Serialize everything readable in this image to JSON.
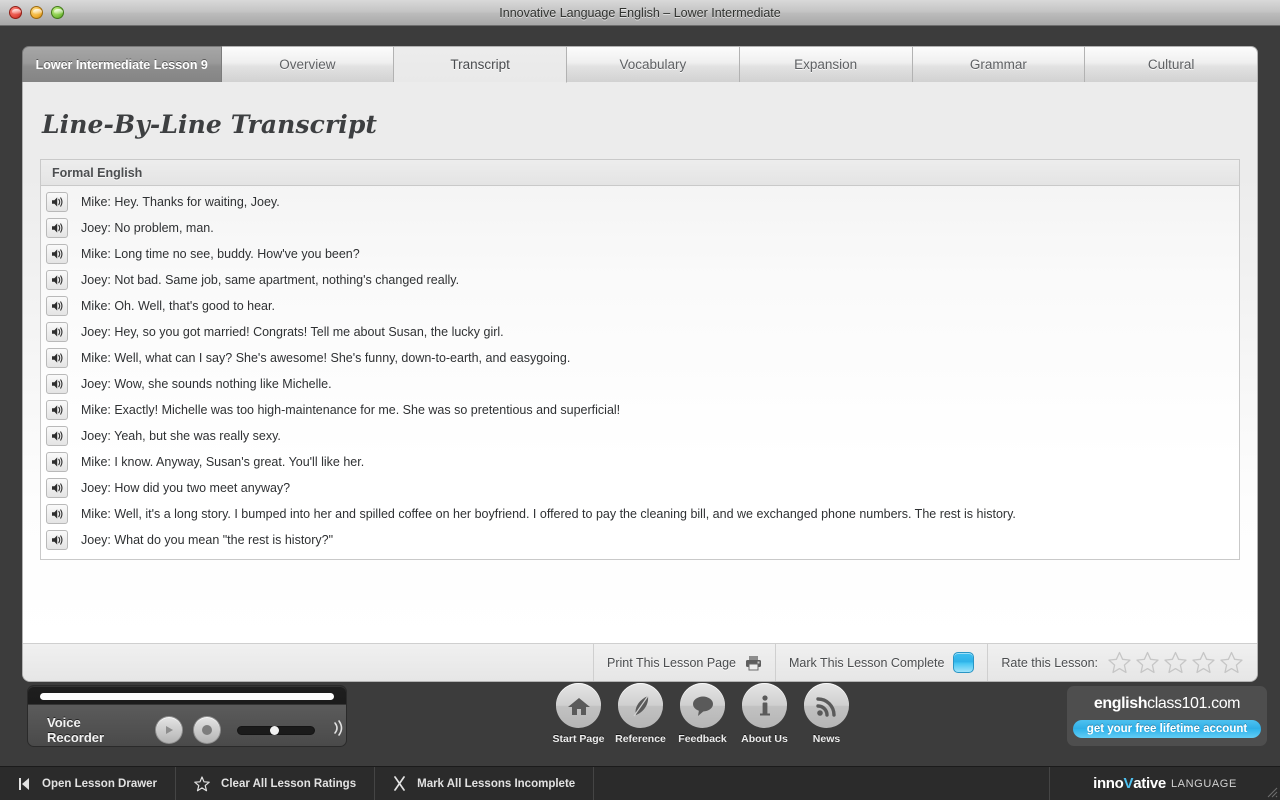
{
  "window": {
    "title": "Innovative Language English – Lower Intermediate",
    "traffic_lights": [
      "close",
      "minimize",
      "zoom"
    ]
  },
  "tabs": [
    {
      "label": "Lower Intermediate Lesson 9",
      "type": "lesson",
      "active": false
    },
    {
      "label": "Overview",
      "type": "tab",
      "active": false
    },
    {
      "label": "Transcript",
      "type": "tab",
      "active": true
    },
    {
      "label": "Vocabulary",
      "type": "tab",
      "active": false
    },
    {
      "label": "Expansion",
      "type": "tab",
      "active": false
    },
    {
      "label": "Grammar",
      "type": "tab",
      "active": false
    },
    {
      "label": "Cultural",
      "type": "tab",
      "active": false
    }
  ],
  "page": {
    "title": "Line-By-Line Transcript",
    "section_header": "Formal English"
  },
  "transcript": [
    {
      "speaker": "Mike",
      "line": "Mike: Hey. Thanks for waiting, Joey."
    },
    {
      "speaker": "Joey",
      "line": "Joey: No problem, man."
    },
    {
      "speaker": "Mike",
      "line": "Mike: Long time no see, buddy. How've you been?"
    },
    {
      "speaker": "Joey",
      "line": "Joey: Not bad. Same job, same apartment, nothing's changed really."
    },
    {
      "speaker": "Mike",
      "line": "Mike: Oh. Well, that's good to hear."
    },
    {
      "speaker": "Joey",
      "line": "Joey: Hey, so you got married! Congrats! Tell me about Susan, the lucky girl."
    },
    {
      "speaker": "Mike",
      "line": "Mike: Well, what can I say? She's awesome! She's funny, down-to-earth, and easygoing."
    },
    {
      "speaker": "Joey",
      "line": "Joey: Wow, she sounds nothing like Michelle."
    },
    {
      "speaker": "Mike",
      "line": "Mike: Exactly! Michelle was too high-maintenance for me. She was so pretentious and superficial!"
    },
    {
      "speaker": "Joey",
      "line": "Joey: Yeah, but she was really sexy."
    },
    {
      "speaker": "Mike",
      "line": "Mike: I know. Anyway, Susan's great. You'll like her."
    },
    {
      "speaker": "Joey",
      "line": "Joey: How did you two meet anyway?"
    },
    {
      "speaker": "Mike",
      "line": "Mike: Well, it's a long story. I bumped into her and spilled coffee on her boyfriend. I offered to pay the cleaning bill, and we exchanged phone numbers. The rest is history."
    },
    {
      "speaker": "Joey",
      "line": "Joey: What do you mean \"the rest is history?\""
    }
  ],
  "panel_footer": {
    "print_label": "Print This Lesson Page",
    "print_icon": "printer-icon",
    "complete_label": "Mark This Lesson Complete",
    "complete_checked": false,
    "rate_label": "Rate this Lesson:",
    "stars_total": 5,
    "stars_filled": 0
  },
  "voice_recorder": {
    "label": "Voice Recorder",
    "play_icon": "play-icon",
    "record_icon": "record-icon",
    "volume_icon": "volume-icon",
    "volume_percent": 46
  },
  "dock_nav": [
    {
      "label": "Start Page",
      "icon": "home-icon"
    },
    {
      "label": "Reference",
      "icon": "feather-icon"
    },
    {
      "label": "Feedback",
      "icon": "speech-bubble-icon"
    },
    {
      "label": "About Us",
      "icon": "info-icon"
    },
    {
      "label": "News",
      "icon": "rss-icon"
    }
  ],
  "brand": {
    "name_bold": "english",
    "name_rest": "class101.com",
    "cta": "get your free lifetime account"
  },
  "statusbar": {
    "items": [
      {
        "label": "Open Lesson Drawer",
        "icon": "drawer-arrow-icon"
      },
      {
        "label": "Clear All Lesson Ratings",
        "icon": "star-outline-icon"
      },
      {
        "label": "Mark All Lessons Incomplete",
        "icon": "x-mark-icon"
      }
    ],
    "logo_pre": "inno",
    "logo_v": "V",
    "logo_post": "ative",
    "logo_suffix": "LANGUAGE"
  },
  "colors": {
    "accent_blue": "#3dbff0",
    "window_chrome": "#3c3c3c",
    "statusbar": "#2b2b2b",
    "panel": "#ececec"
  }
}
